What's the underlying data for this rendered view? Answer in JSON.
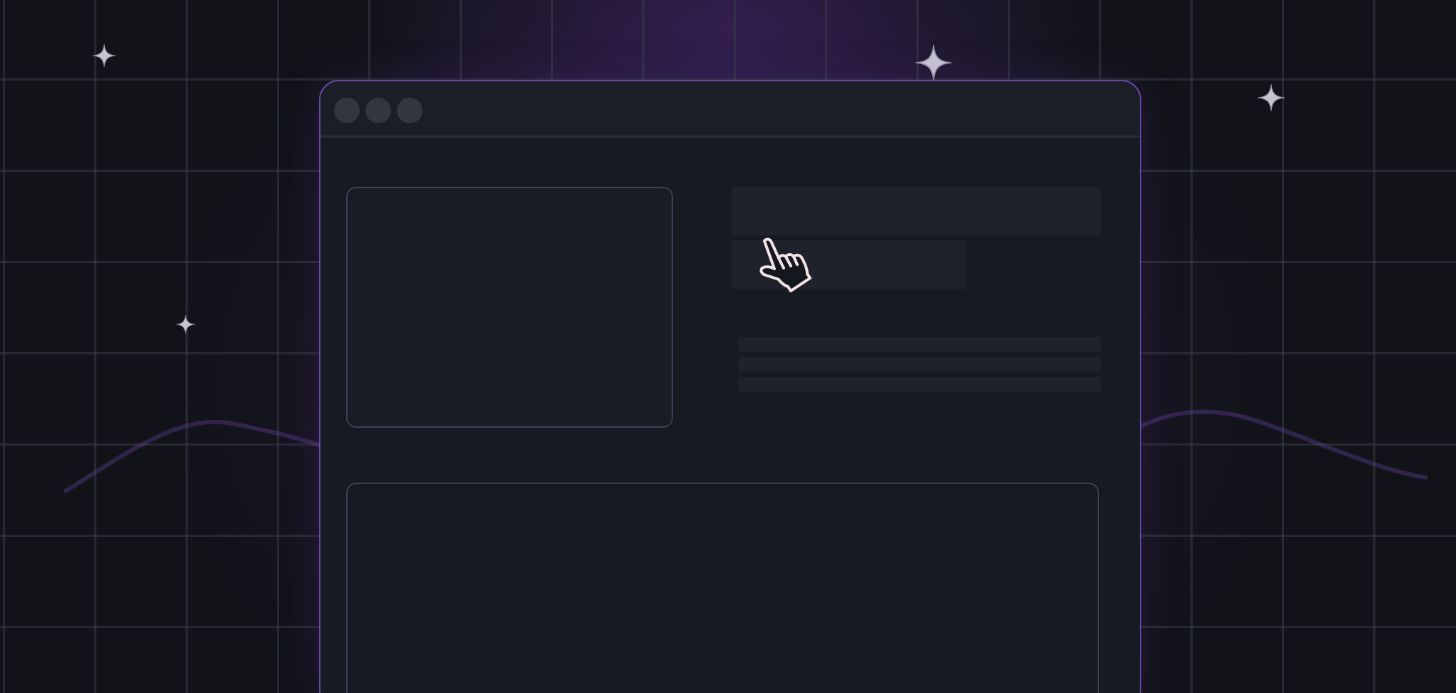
{
  "window": {
    "accent_color": "#6a4aa8",
    "background_color": "#161a22",
    "titlebar": {
      "controls": [
        "window-dot",
        "window-dot",
        "window-dot"
      ],
      "dot_color": "#33353f"
    }
  },
  "content": {
    "media_card": {
      "icon": null
    },
    "title_placeholder": "",
    "subtitle_placeholder": "",
    "text_lines": [
      "",
      "",
      ""
    ],
    "main_panel": {}
  },
  "cursor": {
    "icon": "pointing-hand-cursor-icon",
    "color": "#f3e3e6"
  },
  "decor": {
    "sparkles": [
      "sparkle-icon",
      "sparkle-icon",
      "sparkle-icon",
      "sparkle-icon"
    ],
    "glow_color": "#5c2e96",
    "grid_color": "#3a3c48"
  }
}
